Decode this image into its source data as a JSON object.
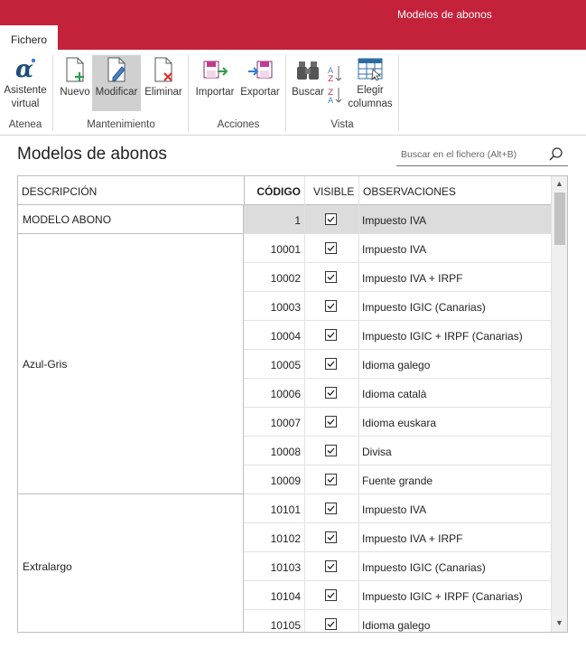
{
  "window": {
    "title": "Modelos de abonos"
  },
  "tabs": {
    "file": "Fichero"
  },
  "ribbon": {
    "assistant": "Asistente virtual",
    "new": "Nuevo",
    "modify": "Modificar",
    "delete": "Eliminar",
    "import": "Importar",
    "export": "Exportar",
    "search": "Buscar",
    "choose_columns": "Elegir columnas",
    "groups": {
      "atenea": "Atenea",
      "maintenance": "Mantenimiento",
      "actions": "Acciones",
      "view": "Vista"
    }
  },
  "page": {
    "title": "Modelos de abonos",
    "search_placeholder": "Buscar en el fichero (Alt+B)"
  },
  "table": {
    "headers": {
      "description": "DESCRIPCIÓN",
      "code": "CÓDIGO",
      "visible": "VISIBLE",
      "observations": "OBSERVACIONES"
    },
    "groups": [
      {
        "label": "MODELO ABONO",
        "rows": [
          {
            "code": "1",
            "visible": true,
            "obs": "Impuesto IVA",
            "selected": true
          }
        ]
      },
      {
        "label": "Azul-Gris",
        "rows": [
          {
            "code": "10001",
            "visible": true,
            "obs": "Impuesto IVA"
          },
          {
            "code": "10002",
            "visible": true,
            "obs": "Impuesto IVA + IRPF"
          },
          {
            "code": "10003",
            "visible": true,
            "obs": "Impuesto IGIC (Canarias)"
          },
          {
            "code": "10004",
            "visible": true,
            "obs": "Impuesto IGIC + IRPF (Canarias)"
          },
          {
            "code": "10005",
            "visible": true,
            "obs": "Idioma galego"
          },
          {
            "code": "10006",
            "visible": true,
            "obs": "Idioma català"
          },
          {
            "code": "10007",
            "visible": true,
            "obs": "Idioma euskara"
          },
          {
            "code": "10008",
            "visible": true,
            "obs": "Divisa"
          },
          {
            "code": "10009",
            "visible": true,
            "obs": "Fuente grande"
          }
        ]
      },
      {
        "label": "Extralargo",
        "rows": [
          {
            "code": "10101",
            "visible": true,
            "obs": "Impuesto IVA"
          },
          {
            "code": "10102",
            "visible": true,
            "obs": "Impuesto IVA + IRPF"
          },
          {
            "code": "10103",
            "visible": true,
            "obs": "Impuesto IGIC (Canarias)"
          },
          {
            "code": "10104",
            "visible": true,
            "obs": "Impuesto IGIC + IRPF (Canarias)"
          },
          {
            "code": "10105",
            "visible": true,
            "obs": "Idioma galego"
          }
        ]
      }
    ]
  },
  "colors": {
    "accent": "#c4213b",
    "selected_row": "#dcdcdc"
  }
}
